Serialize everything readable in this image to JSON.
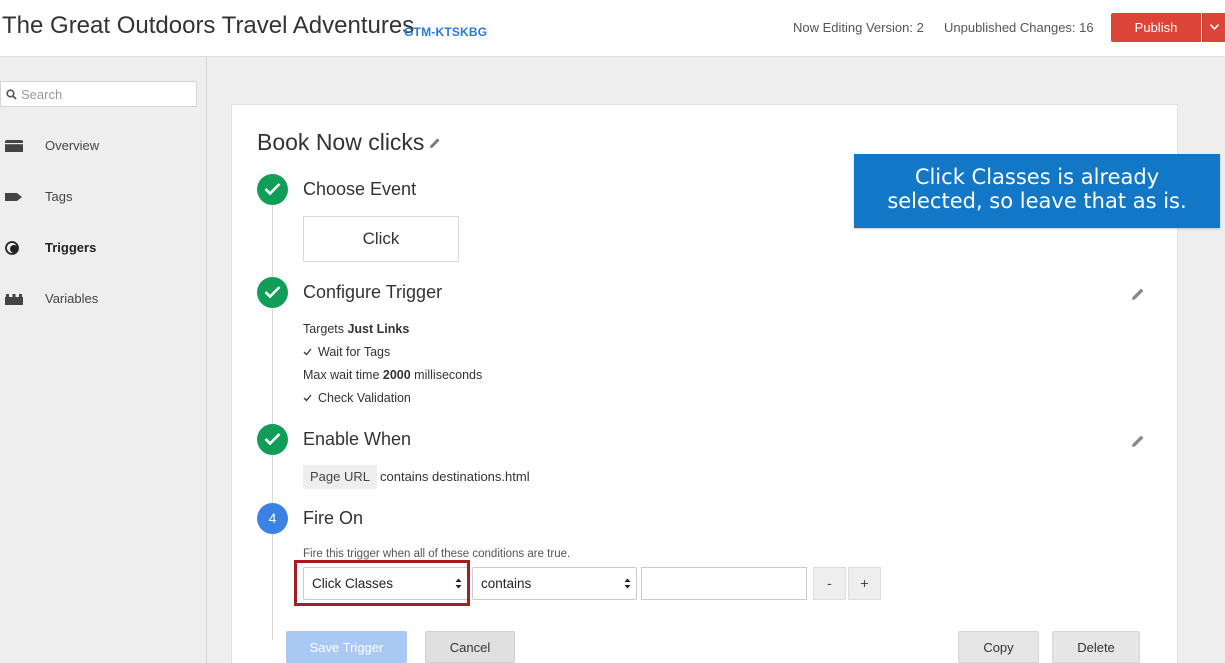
{
  "header": {
    "title": "The Great Outdoors Travel Adventures",
    "container_id": "GTM-KTSKBG",
    "editing_version": "Now Editing Version: 2",
    "unpublished_changes": "Unpublished Changes: 16",
    "publish_label": "Publish"
  },
  "sidebar": {
    "search_placeholder": "Search",
    "items": [
      {
        "label": "Overview",
        "icon": "folder-icon"
      },
      {
        "label": "Tags",
        "icon": "tag-icon"
      },
      {
        "label": "Triggers",
        "icon": "trigger-icon"
      },
      {
        "label": "Variables",
        "icon": "blocks-icon"
      }
    ],
    "active_item": "Triggers"
  },
  "trigger": {
    "name": "Book Now clicks",
    "steps": [
      {
        "title": "Choose Event",
        "status": "complete",
        "value": "Click"
      },
      {
        "title": "Configure Trigger",
        "status": "complete"
      },
      {
        "title": "Enable When",
        "status": "complete"
      },
      {
        "title": "Fire On",
        "status": "current",
        "number": "4"
      }
    ],
    "configure": {
      "targets_prefix": "Targets ",
      "targets_value": "Just Links",
      "wait_for_tags": "Wait for Tags",
      "max_wait_prefix": "Max wait time ",
      "max_wait_value": "2000",
      "max_wait_suffix": " milliseconds",
      "check_validation": "Check Validation"
    },
    "enable_when": {
      "variable": "Page URL",
      "condition": "contains destinations.html"
    },
    "fire_on": {
      "description": "Fire this trigger when all of these conditions are true.",
      "variable": "Click Classes",
      "operator": "contains",
      "value": "",
      "remove_label": "-",
      "add_label": "+"
    }
  },
  "buttons": {
    "save": "Save Trigger",
    "cancel": "Cancel",
    "copy": "Copy",
    "delete": "Delete"
  },
  "callout": {
    "line1": "Click Classes is already",
    "line2": "selected, so leave that as is."
  },
  "colors": {
    "publish": "#db4437",
    "complete": "#0f9d58",
    "current": "#3b82e4",
    "callout": "#1177c6",
    "highlight": "#a51d1d"
  }
}
